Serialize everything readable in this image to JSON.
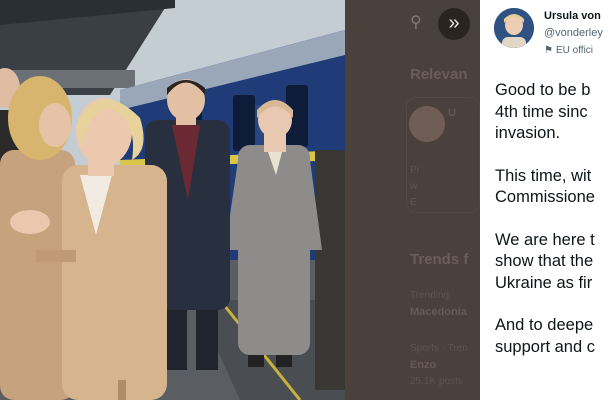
{
  "sidebar": {
    "expand_icon": "expand-arrows-icon",
    "search_icon": "search-icon",
    "relevant_heading": "Relevan",
    "relevant_user": "U",
    "relevant_lines": [
      "Pr",
      "w",
      "E"
    ],
    "trends_heading": "Trends f",
    "trends": [
      {
        "context": "Trending",
        "name": "Macedonia"
      },
      {
        "context": "Sports · Tren",
        "name": "Enzo"
      }
    ],
    "trend_count": "25.1K posts"
  },
  "tweet": {
    "author_name": "Ursula von",
    "author_handle": "@vonderley",
    "affiliation_label": "EU offici",
    "affiliation_icon": "flag-icon",
    "paragraphs": [
      "Good to be b\n4th time sinc\ninvasion.",
      "This time, wit\nCommissione",
      "We are here t\nshow that the\nUkraine as fir",
      "And to deepe\nsupport and c"
    ]
  }
}
